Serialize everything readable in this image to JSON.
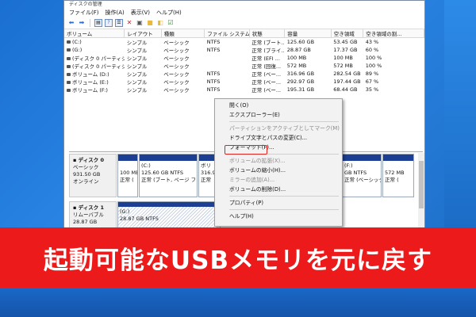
{
  "window": {
    "title": "ディスクの管理"
  },
  "menu": [
    "ファイル(F)",
    "操作(A)",
    "表示(V)",
    "ヘルプ(H)"
  ],
  "toolbar_icons": [
    "back-arrow-icon",
    "forward-arrow-icon",
    "console-tree-icon",
    "help-icon",
    "list-view-icon",
    "close-x-icon",
    "properties-icon",
    "folder-icon",
    "rescan-icon",
    "check-icon"
  ],
  "table": {
    "columns": [
      "ボリューム",
      "レイアウト",
      "種類",
      "ファイル システム",
      "状態",
      "容量",
      "空き領域",
      "空き領域の割..."
    ],
    "rows": [
      [
        "(C:)",
        "シンプル",
        "ベーシック",
        "NTFS",
        "正常 (ブート...",
        "125.60 GB",
        "53.45 GB",
        "43 %"
      ],
      [
        "(G:)",
        "シンプル",
        "ベーシック",
        "NTFS",
        "正常 (プライ...",
        "28.87 GB",
        "17.37 GB",
        "60 %"
      ],
      [
        "(ディスク 0 パーティシ...",
        "シンプル",
        "ベーシック",
        "",
        "正常 (EFI ...",
        "100 MB",
        "100 MB",
        "100 %"
      ],
      [
        "(ディスク 0 パーティシ...",
        "シンプル",
        "ベーシック",
        "",
        "正常 (回復...",
        "572 MB",
        "572 MB",
        "100 %"
      ],
      [
        "ボリューム (D:)",
        "シンプル",
        "ベーシック",
        "NTFS",
        "正常 (ベー...",
        "316.96 GB",
        "282.54 GB",
        "89 %"
      ],
      [
        "ボリューム (E:)",
        "シンプル",
        "ベーシック",
        "NTFS",
        "正常 (ベー...",
        "292.97 GB",
        "197.44 GB",
        "67 %"
      ],
      [
        "ボリューム (F:)",
        "シンプル",
        "ベーシック",
        "NTFS",
        "正常 (ベー...",
        "195.31 GB",
        "68.44 GB",
        "35 %"
      ]
    ]
  },
  "disk0": {
    "label": "ディスク 0",
    "type": "ベーシック",
    "size": "931.50 GB",
    "status": "オンライン",
    "parts": [
      {
        "name": "",
        "size": "100 ME",
        "status": "正常 ("
      },
      {
        "name": "(C:)",
        "size": "125.60 GB NTFS",
        "status": "正常 (ブート, ページ フ"
      },
      {
        "name": "ボリ",
        "size": "316.9",
        "status": "正常"
      },
      {
        "name": "(F:)",
        "size": "GB NTFS",
        "status": "正常 (ベーシック デー"
      },
      {
        "name": "",
        "size": "572 MB",
        "status": "正常 ("
      }
    ]
  },
  "disk1": {
    "label": "ディスク 1",
    "type": "リムーバブル",
    "size": "28.87 GB",
    "part": {
      "name": "(G:)",
      "size": "28.87 GB NTFS"
    }
  },
  "context_menu": [
    {
      "label": "開く(O)",
      "enabled": true
    },
    {
      "label": "エクスプローラー(E)",
      "enabled": true
    },
    {
      "sep": true
    },
    {
      "label": "パーティションをアクティブとしてマーク(M)",
      "enabled": false
    },
    {
      "label": "ドライブ文字とパスの変更(C)...",
      "enabled": true
    },
    {
      "label": "フォーマット(F)...",
      "enabled": true,
      "highlight": true
    },
    {
      "sep": true
    },
    {
      "label": "ボリュームの拡張(X)...",
      "enabled": false
    },
    {
      "label": "ボリュームの縮小(H)...",
      "enabled": true
    },
    {
      "label": "ミラーの追加(A)...",
      "enabled": false
    },
    {
      "label": "ボリュームの削除(D)...",
      "enabled": true
    },
    {
      "sep": true
    },
    {
      "label": "プロパティ(P)",
      "enabled": true
    },
    {
      "sep": true
    },
    {
      "label": "ヘルプ(H)",
      "enabled": true
    }
  ],
  "banner": {
    "text": "起動可能なUSBメモリを元に戻す",
    "color": "#ec1a1a"
  }
}
